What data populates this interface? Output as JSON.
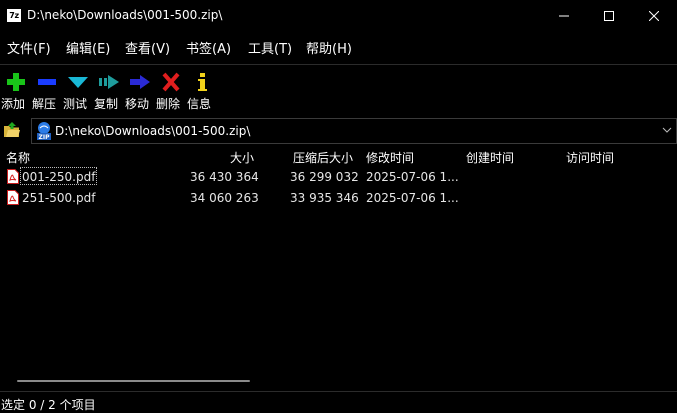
{
  "window": {
    "app_icon_text": "7z",
    "title": "D:\\neko\\Downloads\\001-500.zip\\"
  },
  "menu": [
    {
      "label": "文件(F)"
    },
    {
      "label": "编辑(E)"
    },
    {
      "label": "查看(V)"
    },
    {
      "label": "书签(A)"
    },
    {
      "label": "工具(T)"
    },
    {
      "label": "帮助(H)"
    }
  ],
  "toolbar": [
    {
      "label": "添加",
      "icon": "plus-icon",
      "color": "#19c419"
    },
    {
      "label": "解压",
      "icon": "minus-icon",
      "color": "#1a3cff"
    },
    {
      "label": "测试",
      "icon": "check-chevron-icon",
      "color": "#19b8d6"
    },
    {
      "label": "复制",
      "icon": "copy-arrow-icon",
      "color": "#1e9c9c"
    },
    {
      "label": "移动",
      "icon": "move-arrow-icon",
      "color": "#2a2ad6"
    },
    {
      "label": "删除",
      "icon": "delete-x-icon",
      "color": "#e01e1e"
    },
    {
      "label": "信息",
      "icon": "info-icon",
      "color": "#f2d21a"
    }
  ],
  "address": {
    "path": "D:\\neko\\Downloads\\001-500.zip\\"
  },
  "columns": {
    "name": "名称",
    "size": "大小",
    "packed": "压缩后大小",
    "modified": "修改时间",
    "created": "创建时间",
    "accessed": "访问时间"
  },
  "files": [
    {
      "name": "001-250.pdf",
      "size": "36 430 364",
      "packed": "36 299 032",
      "modified": "2025-07-06 1...",
      "created": "",
      "accessed": ""
    },
    {
      "name": "251-500.pdf",
      "size": "34 060 263",
      "packed": "33 935 346",
      "modified": "2025-07-06 1...",
      "created": "",
      "accessed": ""
    }
  ],
  "status": {
    "text": "选定 0 / 2 个项目"
  }
}
